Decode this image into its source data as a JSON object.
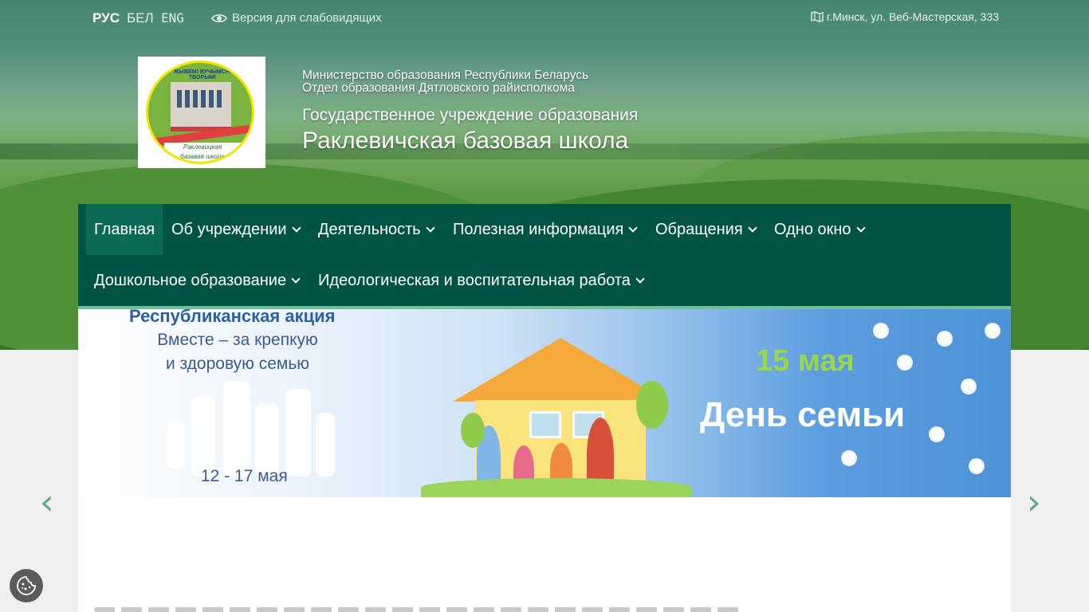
{
  "languages": [
    "РУС",
    "БЕЛ",
    "ENG"
  ],
  "active_language": "РУС",
  "vision_link": "Версия для слабовидящих",
  "address": "г.Минск, ул. Веб-Мастерская, 333",
  "header": {
    "ministry": "Министерство образования Республики Беларусь",
    "department": "Отдел образования Дятловского райисполкома",
    "institution_type": "Государственное учреждение образования",
    "school_name": "Раклевичская базовая школа"
  },
  "logo": {
    "ring_text": "ЖЫВЕМ! ВУЧЫМСЯ! ТВОРЫМ!",
    "caption_line1": "Раклевицкая",
    "caption_line2": "базавая школа"
  },
  "nav": {
    "row1": [
      "Главная",
      "Об учреждении",
      "Деятельность",
      "Полезная информация",
      "Обращения",
      "Одно окно"
    ],
    "row2": [
      "Дошкольное образование",
      "Идеологическая и воспитательная работа"
    ],
    "active": "Главная"
  },
  "banner": {
    "title": "Республиканская акция",
    "subtitle_line1": "Вместе – за крепкую",
    "subtitle_line2": "и здоровую семью",
    "dates": "12 - 17 мая",
    "date_big": "15 мая",
    "day_name": "День семьи"
  },
  "slider": {
    "prev": "‹",
    "next": "›"
  },
  "colors": {
    "nav_bg": "#015443",
    "nav_active": "#0b6a56",
    "accent": "#6fbf9b",
    "arrow": "#5ea87c"
  }
}
